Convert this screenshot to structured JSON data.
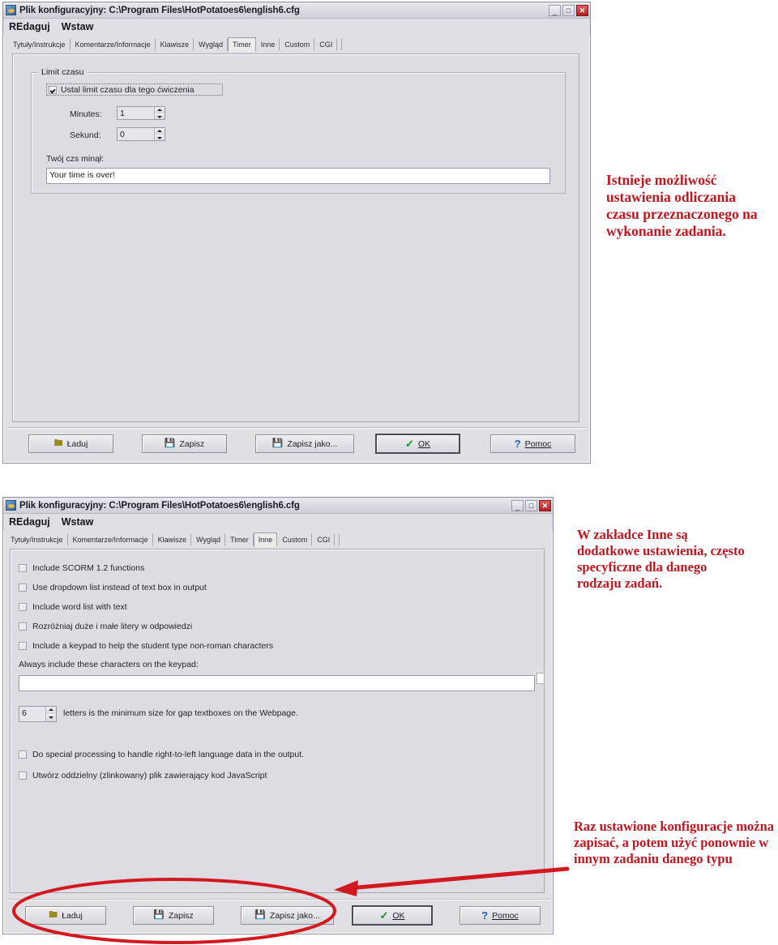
{
  "window_timer": {
    "title": "Plik konfiguracyjny: C:\\Program Files\\HotPotatoes6\\english6.cfg",
    "icon": "hotpotatoes-icon",
    "controls": {
      "minimize": "_",
      "maximize": "□",
      "close": "✕"
    },
    "menu": [
      "REdaguj",
      "Wstaw"
    ],
    "tabs": [
      "Tytuły/Instrukcje",
      "Komentarze/Informacje",
      "Klawisze",
      "Wygląd",
      "Timer",
      "Inne",
      "Custom",
      "CGI"
    ],
    "active_tab": "Timer",
    "group_title": "Limit czasu",
    "enable_checkbox": {
      "label": "Ustal limit czasu dla tego ćwiczenia",
      "checked": true
    },
    "minutes_label": "Minutes:",
    "minutes_value": "1",
    "seconds_label": "Sekund:",
    "seconds_value": "0",
    "message_label": "Twój czs minął:",
    "message_value": "Your time is over!",
    "buttons": [
      {
        "label": "Ładuj",
        "icon": "open-folder-icon",
        "underline": "Ł",
        "default": false
      },
      {
        "label": "Zapisz",
        "icon": "floppy-disk-icon",
        "underline": "Z",
        "default": false
      },
      {
        "label": "Zapisz jako...",
        "icon": "floppy-disk-save-as-icon",
        "underline": "j",
        "default": false
      },
      {
        "label": "OK",
        "icon": "green-check-icon",
        "underline": "O",
        "default": true
      },
      {
        "label": "Pomoc",
        "icon": "blue-question-icon",
        "underline": "P",
        "default": false
      }
    ]
  },
  "window_inne": {
    "title": "Plik konfiguracyjny: C:\\Program Files\\HotPotatoes6\\english6.cfg",
    "icon": "hotpotatoes-icon",
    "controls": {
      "minimize": "_",
      "maximize": "□",
      "close": "✕"
    },
    "menu": [
      "REdaguj",
      "Wstaw"
    ],
    "tabs": [
      "Tytuły/Instrukcje",
      "Komentarze/Informacje",
      "Klawisze",
      "Wygląd",
      "Timer",
      "Inne",
      "Custom",
      "CGI"
    ],
    "active_tab": "Inne",
    "checkboxes_top": [
      {
        "label": "Include SCORM 1.2 functions",
        "checked": false
      },
      {
        "label": "Use dropdown list instead of text box in output",
        "checked": false
      },
      {
        "label": "Include word list with text",
        "checked": false
      },
      {
        "label": "Rozróżniaj duże i małe litery w odpowiedzi",
        "checked": false
      },
      {
        "label": "Include a keypad to help the student type non-roman characters",
        "checked": false
      }
    ],
    "keypad_label": "Always include these characters on the keypad:",
    "keypad_value": "",
    "gap_size_value": "6",
    "gap_size_label": "letters is the minimum size for gap textboxes on the Webpage.",
    "checkboxes_bottom": [
      {
        "label": "Do special processing to handle right-to-left language data in the output.",
        "checked": false
      },
      {
        "label": "Utwórz oddzielny (zlinkowany) plik zawierający kod JavaScript",
        "checked": false
      }
    ],
    "buttons": [
      {
        "label": "Ładuj",
        "icon": "open-folder-icon",
        "underline": "Ł",
        "default": false
      },
      {
        "label": "Zapisz",
        "icon": "floppy-disk-icon",
        "underline": "Z",
        "default": false
      },
      {
        "label": "Zapisz jako...",
        "icon": "floppy-disk-save-as-icon",
        "underline": "j",
        "default": false
      },
      {
        "label": "OK",
        "icon": "green-check-icon",
        "underline": "O",
        "default": true
      },
      {
        "label": "Pomoc",
        "icon": "blue-question-icon",
        "underline": "P",
        "default": false
      }
    ]
  },
  "annotations": {
    "color": "#c01620",
    "note_timer": "Istnieje możliwość ustawienia odliczania czasu przeznaczonego na wykonanie zadania.",
    "note_inne": "W zakładce Inne są dodatkowe ustawienia, często specyficzne dla danego rodzaju zadań.",
    "note_save": "Raz ustawione konfiguracje można zapisać, a potem użyć ponownie w innym zadaniu danego typu",
    "ellipse": "red-ellipse-highlight",
    "arrow": "red-arrow-pointer"
  }
}
